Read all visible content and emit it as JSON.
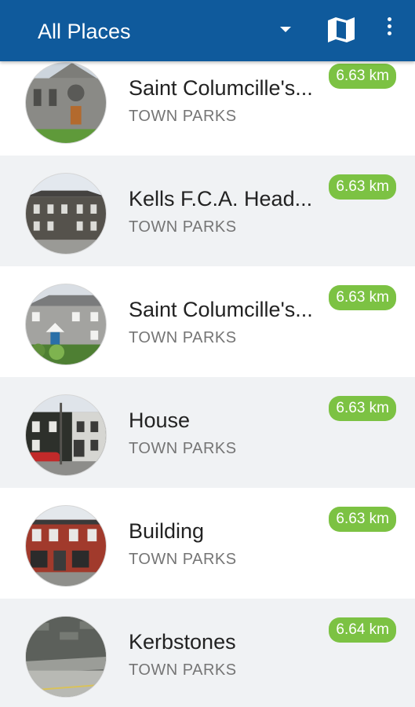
{
  "toolbar": {
    "title": "All Places",
    "dropdown_icon": "triangle-down-icon",
    "map_icon": "map-icon",
    "more_icon": "more-vert-icon",
    "color": "#0f5a9c"
  },
  "places": [
    {
      "name": "Saint Columcille's...",
      "area": "TOWN PARKS",
      "distance": "6.63 km"
    },
    {
      "name": "Kells F.C.A. Head...",
      "area": "TOWN PARKS",
      "distance": "6.63 km"
    },
    {
      "name": "Saint Columcille's...",
      "area": "TOWN PARKS",
      "distance": "6.63 km"
    },
    {
      "name": "House",
      "area": "TOWN PARKS",
      "distance": "6.63 km"
    },
    {
      "name": "Building",
      "area": "TOWN PARKS",
      "distance": "6.63 km"
    },
    {
      "name": "Kerbstones",
      "area": "TOWN PARKS",
      "distance": "6.64 km"
    }
  ],
  "colors": {
    "distance_badge": "#7cc243",
    "row_alt": "#f0f2f4"
  }
}
